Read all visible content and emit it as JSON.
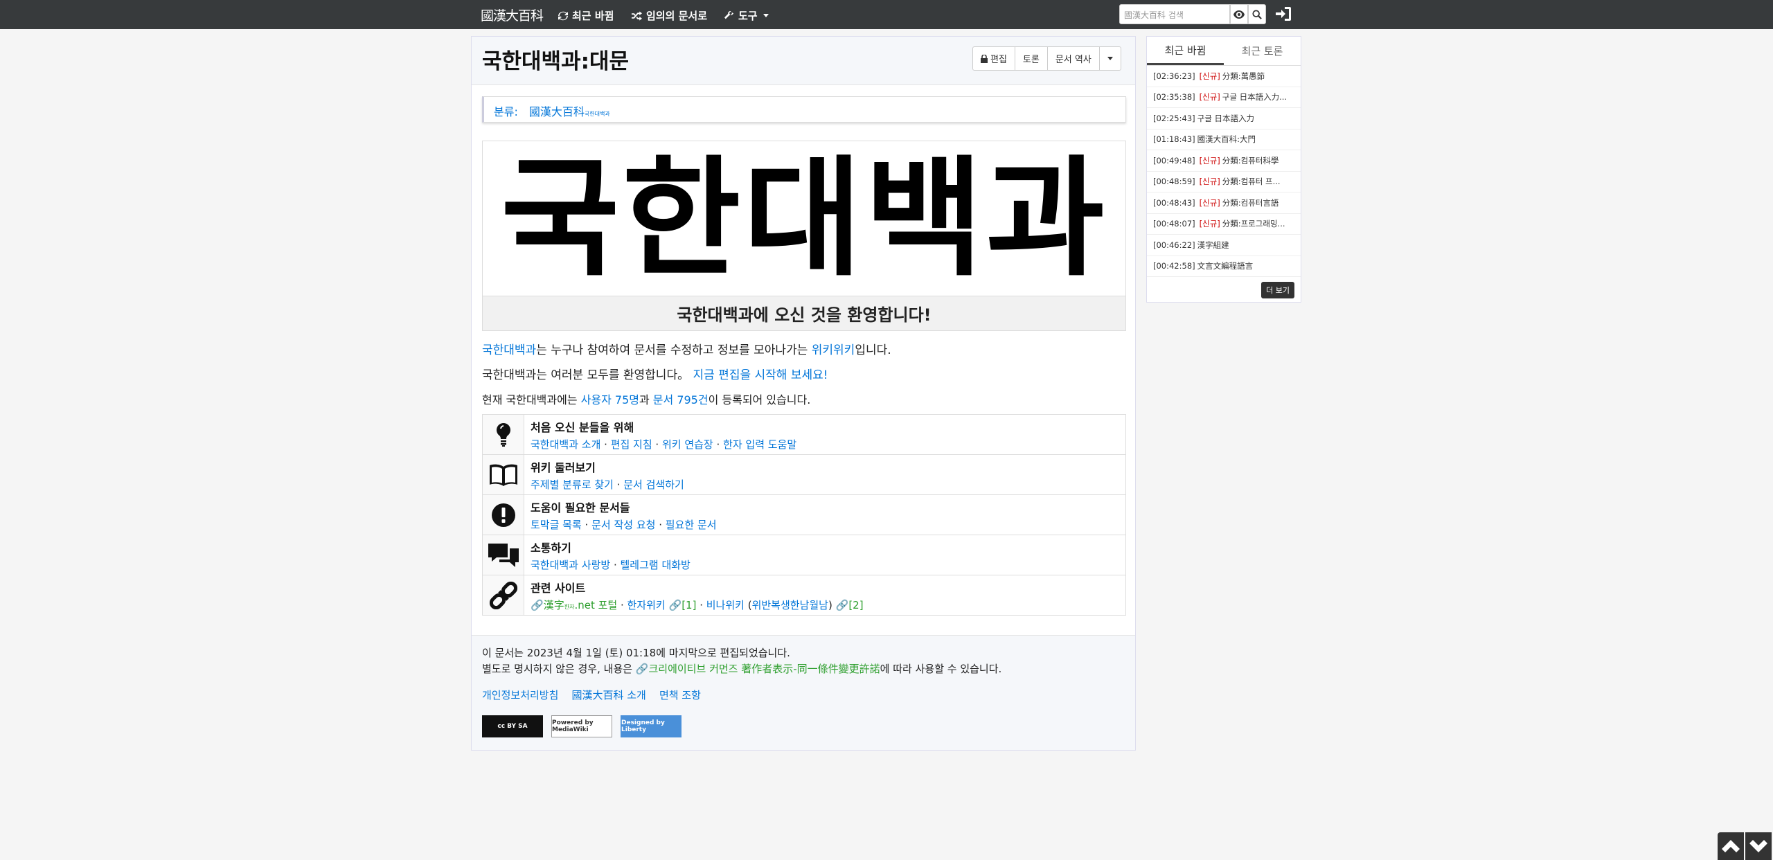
{
  "navbar": {
    "brand": "國漢大百科",
    "recent_changes": "최근 바뀜",
    "random_doc": "임의의 문서로",
    "tools": "도구",
    "search_placeholder": "國漢大百科 검색"
  },
  "page": {
    "title": "국한대백과:대문",
    "btn_edit": "편집",
    "btn_discuss": "토론",
    "btn_history": "문서 역사",
    "category_label": "분류:",
    "category_link": "國漢大百科",
    "category_sub": "국한대백과",
    "banner_text": "국한대백과",
    "welcome": "국한대백과에 오신 것을 환영합니다!",
    "p1": {
      "link": "국한대백과",
      "mid": "는 누구나 참여하여 문서를 수정하고 정보를 모아나가는 ",
      "link2": "위키위키",
      "end": "입니다."
    },
    "p2": {
      "pre": "국한대백과는 여러분 모두를 환영합니다。 ",
      "link": "지금 편집을 시작해 보세요!"
    },
    "p3": {
      "pre": "현재 국한대백과에는 ",
      "users": "사용자 75명",
      "mid": "과 ",
      "docs": "문서 795건",
      "end": "이 등록되어 있습니다."
    }
  },
  "guide": [
    {
      "icon": "lightbulb-icon",
      "title": "처음 오신 분들을 위해",
      "links": [
        "국한대백과 소개",
        "편집 지침",
        "위키 연습장",
        "한자 입력 도움말"
      ]
    },
    {
      "icon": "book-icon",
      "title": "위키 둘러보기",
      "links": [
        "주제별 분류로 찾기",
        "문서 검색하기"
      ]
    },
    {
      "icon": "exclamation-icon",
      "title": "도움이 필요한 문서들",
      "links": [
        "토막글 목록",
        "문서 작성 요청",
        "필요한 문서"
      ]
    },
    {
      "icon": "comments-icon",
      "title": "소통하기",
      "links": [
        "국한대백과 사랑방",
        "텔레그램 대화방"
      ]
    },
    {
      "icon": "link-icon",
      "title": "관련 사이트",
      "ext1": "漢字",
      "ext1_sub": "한자",
      "ext1_tail": ".net 포털",
      "sep": " · ",
      "l2": "한자위키",
      "ext2": "[1]",
      "l3": "비나위키",
      "paren_open": " (",
      "l4": "위반복생한남월남",
      "paren_close": ")",
      "ext3": "[2]"
    }
  ],
  "footer": {
    "last_edit": "이 문서는 2023년 4월 1일 (토) 01:18에 마지막으로 편집되었습니다.",
    "license_pre": "별도로 명시하지 않은 경우, 내용은 ",
    "license_link": "크리에이티브 커먼즈 著作者表示-同一條件變更許諾",
    "license_post": "에 따라 사용할 수 있습니다.",
    "links": [
      "개인정보처리방침",
      "國漢大百科 소개",
      "면책 조항"
    ],
    "badge_cc": "cc BY SA",
    "badge_mw": "Powered by MediaWiki",
    "badge_liberty": "Designed by Liberty"
  },
  "sidebar": {
    "tab_recent": "최근 바뀜",
    "tab_discuss": "최근 토론",
    "items": [
      {
        "time": "[02:36:23]",
        "new": "[신규]",
        "title": "分類:萬愚節"
      },
      {
        "time": "[02:35:38]",
        "new": "[신규]",
        "title": "구글 日本語入力..."
      },
      {
        "time": "[02:25:43]",
        "new": "",
        "title": "구글 日本語入力"
      },
      {
        "time": "[01:18:43]",
        "new": "",
        "title": "國漢大百科:大門"
      },
      {
        "time": "[00:49:48]",
        "new": "[신규]",
        "title": "分類:컴퓨터科學"
      },
      {
        "time": "[00:48:59]",
        "new": "[신규]",
        "title": "分類:컴퓨터 프..."
      },
      {
        "time": "[00:48:43]",
        "new": "[신규]",
        "title": "分類:컴퓨터言語"
      },
      {
        "time": "[00:48:07]",
        "new": "[신규]",
        "title": "分類:프로그래밍..."
      },
      {
        "time": "[00:46:22]",
        "new": "",
        "title": "漢字組建"
      },
      {
        "time": "[00:42:58]",
        "new": "",
        "title": "文言文編程語言"
      }
    ],
    "more": "더 보기"
  },
  "colors": {
    "navbar": "#373a3c",
    "link": "#0275d8",
    "new_tag": "#cc0000",
    "external": "#2e9f2e"
  }
}
